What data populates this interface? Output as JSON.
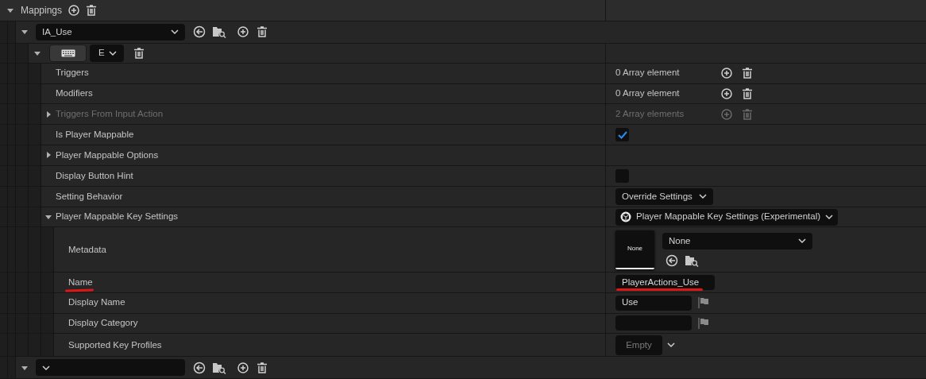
{
  "mappings": {
    "label": "Mappings",
    "expanded": true,
    "actions": [
      {
        "action": "IA_Use",
        "expanded": true,
        "keys": [
          {
            "key": "E",
            "expanded": true,
            "properties": [
              {
                "kind": "array",
                "label": "Triggers",
                "value": "0 Array element",
                "disabled": false
              },
              {
                "kind": "array",
                "label": "Modifiers",
                "value": "0 Array element",
                "disabled": false
              },
              {
                "kind": "array",
                "label": "Triggers From Input Action",
                "value": "2 Array elements",
                "disabled": true,
                "expanded": false
              },
              {
                "kind": "checkbox",
                "label": "Is Player Mappable",
                "checked": true
              },
              {
                "kind": "empty",
                "label": "Player Mappable Options",
                "expanded": false
              },
              {
                "kind": "checkbox",
                "label": "Display Button Hint",
                "checked": false
              },
              {
                "kind": "dropdown",
                "label": "Setting Behavior",
                "value": "Override Settings"
              },
              {
                "kind": "class",
                "label": "Player Mappable Key Settings",
                "value": "Player Mappable Key Settings (Experimental)",
                "expanded": true,
                "children": [
                  {
                    "kind": "asset",
                    "label": "Metadata",
                    "thumbnail": "None",
                    "value": "None"
                  },
                  {
                    "kind": "text",
                    "label": "Name",
                    "value": "PlayerActions_Use",
                    "underlined": true
                  },
                  {
                    "kind": "localized",
                    "label": "Display Name",
                    "value": "Use"
                  },
                  {
                    "kind": "localized",
                    "label": "Display Category"
                  },
                  {
                    "kind": "profiles",
                    "label": "Supported Key Profiles",
                    "value": "Empty"
                  }
                ]
              }
            ]
          }
        ]
      },
      {
        "expanded": true
      }
    ]
  }
}
